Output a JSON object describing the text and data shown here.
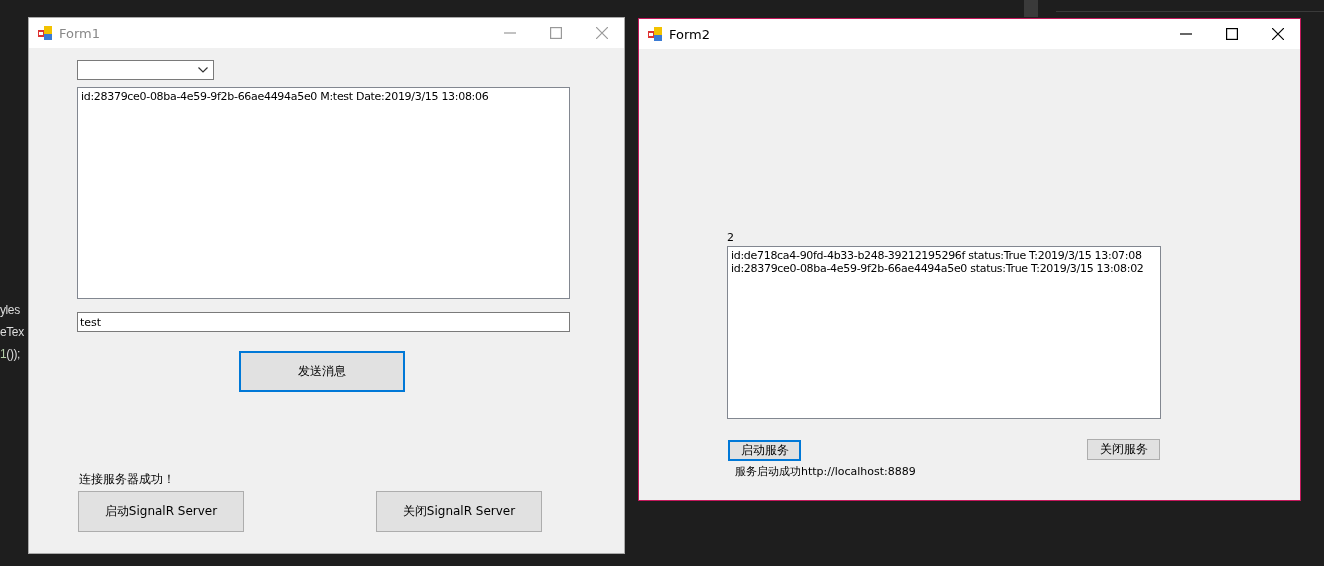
{
  "desktop": {
    "code_lines": [
      {
        "tokens": [
          {
            "text": "yles",
            "kind": "plain"
          }
        ]
      },
      {
        "tokens": [
          {
            "text": "eTex",
            "kind": "plain"
          }
        ]
      },
      {
        "tokens": [
          {
            "text": "1",
            "kind": "number"
          },
          {
            "text": "());",
            "kind": "plain"
          }
        ]
      }
    ]
  },
  "form1": {
    "title": "Form1",
    "active": false,
    "message_log": [
      "id:28379ce0-08ba-4e59-9f2b-66ae4494a5e0 M:test Date:2019/3/15 13:08:06"
    ],
    "message_input": "test",
    "send_button": {
      "label": "发送消息",
      "focused": true
    },
    "status": "连接服务器成功！",
    "server_buttons": [
      {
        "label": "启动SignalR Server",
        "focused": false
      },
      {
        "label": "关闭SignalR Server",
        "focused": false
      }
    ]
  },
  "form2": {
    "title": "Form2",
    "active": true,
    "client_count": "2",
    "connections": [
      "id:de718ca4-90fd-4b33-b248-39212195296f status:True T:2019/3/15 13:07:08",
      "id:28379ce0-08ba-4e59-9f2b-66ae4494a5e0 status:True T:2019/3/15 13:08:02"
    ],
    "buttons": [
      {
        "label": "启动服务",
        "focused": true
      },
      {
        "label": "关闭服务",
        "focused": false
      }
    ],
    "status": "服务启动成功http://localhost:8889"
  }
}
